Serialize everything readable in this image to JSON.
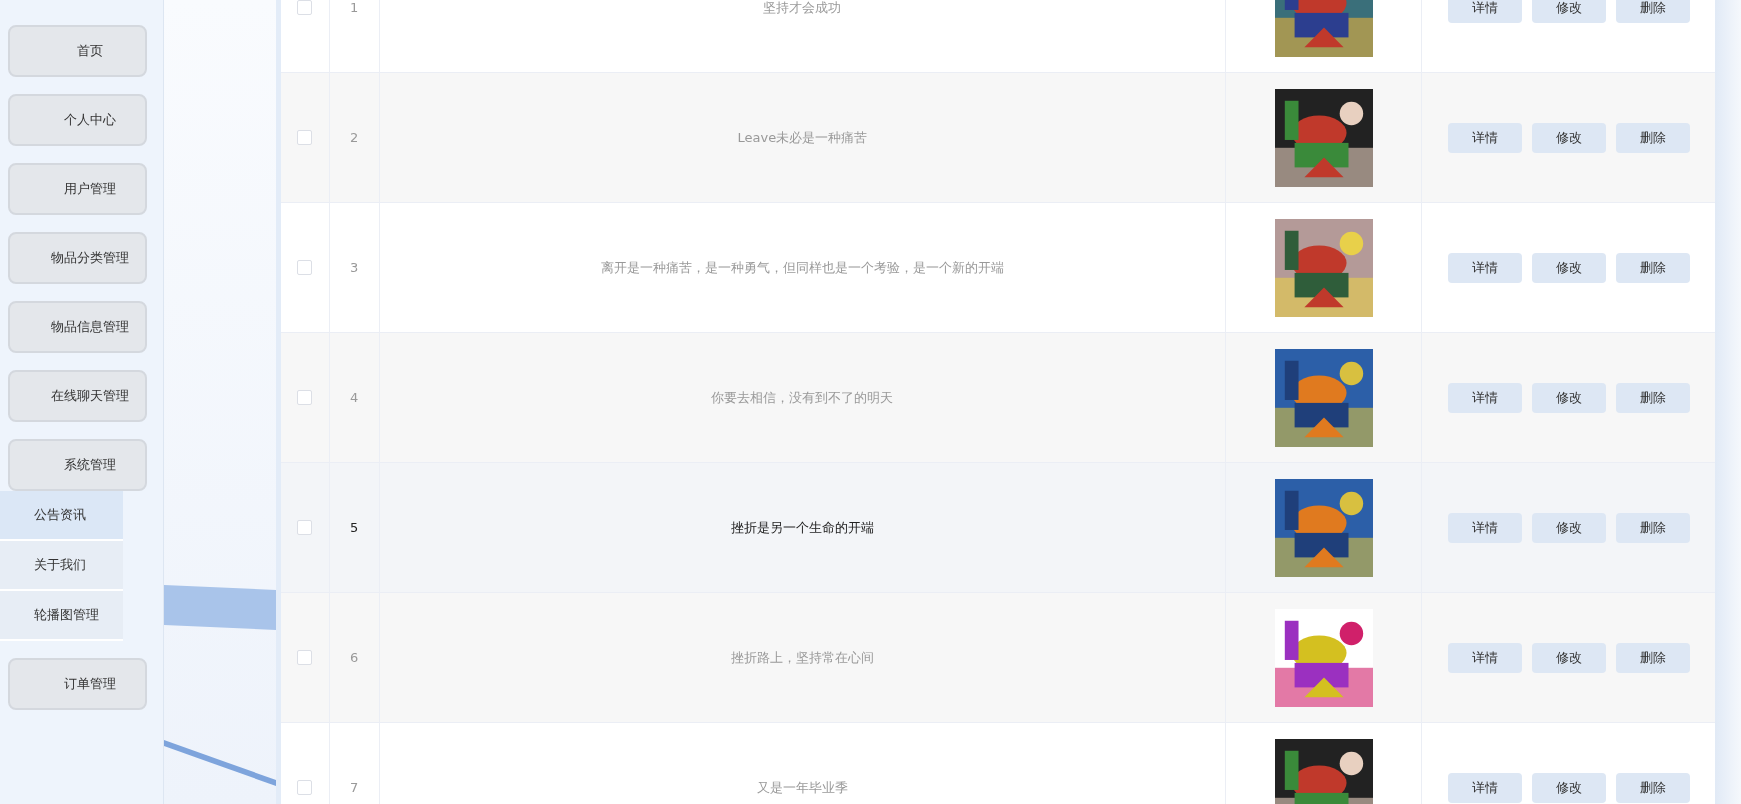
{
  "sidebar": {
    "items": [
      {
        "label": "首页"
      },
      {
        "label": "个人中心"
      },
      {
        "label": "用户管理"
      },
      {
        "label": "物品分类管理"
      },
      {
        "label": "物品信息管理"
      },
      {
        "label": "在线聊天管理"
      },
      {
        "label": "系统管理",
        "children": [
          {
            "label": "公告资讯",
            "selected": true
          },
          {
            "label": "关于我们",
            "selected": false
          },
          {
            "label": "轮播图管理",
            "selected": false
          }
        ]
      },
      {
        "label": "订单管理"
      }
    ]
  },
  "table": {
    "rows": [
      {
        "index": "1",
        "text": "坚持才会成功",
        "checked": false,
        "highlighted": false,
        "actions": [
          "详情",
          "修改",
          "删除"
        ]
      },
      {
        "index": "2",
        "text": "Leave未必是一种痛苦",
        "checked": false,
        "highlighted": false,
        "actions": [
          "详情",
          "修改",
          "删除"
        ]
      },
      {
        "index": "3",
        "text": "离开是一种痛苦，是一种勇气，但同样也是一个考验，是一个新的开端",
        "checked": false,
        "highlighted": false,
        "actions": [
          "详情",
          "修改",
          "删除"
        ]
      },
      {
        "index": "4",
        "text": "你要去相信，没有到不了的明天",
        "checked": false,
        "highlighted": false,
        "actions": [
          "详情",
          "修改",
          "删除"
        ]
      },
      {
        "index": "5",
        "text": "挫折是另一个生命的开端",
        "checked": false,
        "highlighted": true,
        "actions": [
          "详情",
          "修改",
          "删除"
        ]
      },
      {
        "index": "6",
        "text": "挫折路上，坚持常在心间",
        "checked": false,
        "highlighted": false,
        "actions": [
          "详情",
          "修改",
          "删除"
        ]
      },
      {
        "index": "7",
        "text": "又是一年毕业季",
        "checked": false,
        "highlighted": false,
        "actions": [
          "详情",
          "修改",
          "删除"
        ]
      }
    ]
  }
}
